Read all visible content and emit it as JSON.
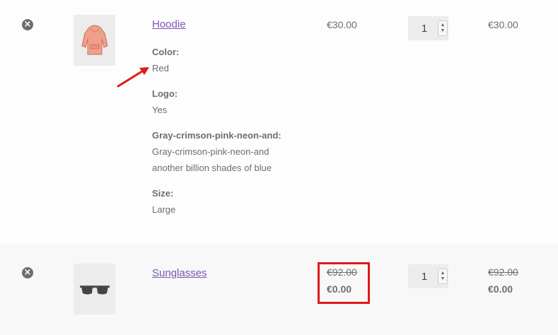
{
  "items": [
    {
      "remove_icon": "×",
      "name": "Hoodie",
      "thumbnail_icon": "hoodie-image",
      "attributes": [
        {
          "label": "Color:",
          "value": "Red"
        },
        {
          "label": "Logo:",
          "value": "Yes"
        },
        {
          "label": "Gray-crimson-pink-neon-and:",
          "value": "Gray-crimson-pink-neon-and another billion shades of blue"
        },
        {
          "label": "Size:",
          "value": "Large"
        }
      ],
      "price": "€30.00",
      "quantity": "1",
      "subtotal": "€30.00"
    },
    {
      "remove_icon": "×",
      "name": "Sunglasses",
      "thumbnail_icon": "sunglasses-image",
      "price_old": "€92.00",
      "price_new": "€0.00",
      "quantity": "1",
      "subtotal_old": "€92.00",
      "subtotal_new": "€0.00"
    }
  ],
  "annotation": {
    "arrow_color": "#e01919",
    "highlight_color": "#e01919"
  },
  "colors": {
    "link": "#7f54b3",
    "text": "#6d6d6d"
  }
}
